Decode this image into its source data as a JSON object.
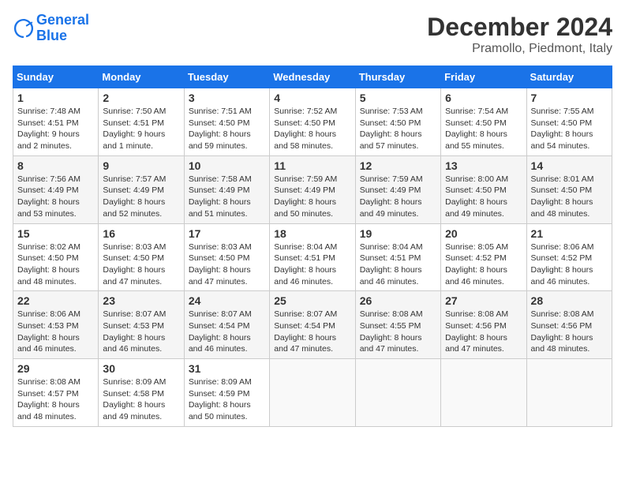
{
  "header": {
    "logo_line1": "General",
    "logo_line2": "Blue",
    "title": "December 2024",
    "subtitle": "Pramollo, Piedmont, Italy"
  },
  "calendar": {
    "days_of_week": [
      "Sunday",
      "Monday",
      "Tuesday",
      "Wednesday",
      "Thursday",
      "Friday",
      "Saturday"
    ],
    "weeks": [
      [
        {
          "day": "1",
          "sunrise": "Sunrise: 7:48 AM",
          "sunset": "Sunset: 4:51 PM",
          "daylight": "Daylight: 9 hours and 2 minutes."
        },
        {
          "day": "2",
          "sunrise": "Sunrise: 7:50 AM",
          "sunset": "Sunset: 4:51 PM",
          "daylight": "Daylight: 9 hours and 1 minute."
        },
        {
          "day": "3",
          "sunrise": "Sunrise: 7:51 AM",
          "sunset": "Sunset: 4:50 PM",
          "daylight": "Daylight: 8 hours and 59 minutes."
        },
        {
          "day": "4",
          "sunrise": "Sunrise: 7:52 AM",
          "sunset": "Sunset: 4:50 PM",
          "daylight": "Daylight: 8 hours and 58 minutes."
        },
        {
          "day": "5",
          "sunrise": "Sunrise: 7:53 AM",
          "sunset": "Sunset: 4:50 PM",
          "daylight": "Daylight: 8 hours and 57 minutes."
        },
        {
          "day": "6",
          "sunrise": "Sunrise: 7:54 AM",
          "sunset": "Sunset: 4:50 PM",
          "daylight": "Daylight: 8 hours and 55 minutes."
        },
        {
          "day": "7",
          "sunrise": "Sunrise: 7:55 AM",
          "sunset": "Sunset: 4:50 PM",
          "daylight": "Daylight: 8 hours and 54 minutes."
        }
      ],
      [
        {
          "day": "8",
          "sunrise": "Sunrise: 7:56 AM",
          "sunset": "Sunset: 4:49 PM",
          "daylight": "Daylight: 8 hours and 53 minutes."
        },
        {
          "day": "9",
          "sunrise": "Sunrise: 7:57 AM",
          "sunset": "Sunset: 4:49 PM",
          "daylight": "Daylight: 8 hours and 52 minutes."
        },
        {
          "day": "10",
          "sunrise": "Sunrise: 7:58 AM",
          "sunset": "Sunset: 4:49 PM",
          "daylight": "Daylight: 8 hours and 51 minutes."
        },
        {
          "day": "11",
          "sunrise": "Sunrise: 7:59 AM",
          "sunset": "Sunset: 4:49 PM",
          "daylight": "Daylight: 8 hours and 50 minutes."
        },
        {
          "day": "12",
          "sunrise": "Sunrise: 7:59 AM",
          "sunset": "Sunset: 4:49 PM",
          "daylight": "Daylight: 8 hours and 49 minutes."
        },
        {
          "day": "13",
          "sunrise": "Sunrise: 8:00 AM",
          "sunset": "Sunset: 4:50 PM",
          "daylight": "Daylight: 8 hours and 49 minutes."
        },
        {
          "day": "14",
          "sunrise": "Sunrise: 8:01 AM",
          "sunset": "Sunset: 4:50 PM",
          "daylight": "Daylight: 8 hours and 48 minutes."
        }
      ],
      [
        {
          "day": "15",
          "sunrise": "Sunrise: 8:02 AM",
          "sunset": "Sunset: 4:50 PM",
          "daylight": "Daylight: 8 hours and 48 minutes."
        },
        {
          "day": "16",
          "sunrise": "Sunrise: 8:03 AM",
          "sunset": "Sunset: 4:50 PM",
          "daylight": "Daylight: 8 hours and 47 minutes."
        },
        {
          "day": "17",
          "sunrise": "Sunrise: 8:03 AM",
          "sunset": "Sunset: 4:50 PM",
          "daylight": "Daylight: 8 hours and 47 minutes."
        },
        {
          "day": "18",
          "sunrise": "Sunrise: 8:04 AM",
          "sunset": "Sunset: 4:51 PM",
          "daylight": "Daylight: 8 hours and 46 minutes."
        },
        {
          "day": "19",
          "sunrise": "Sunrise: 8:04 AM",
          "sunset": "Sunset: 4:51 PM",
          "daylight": "Daylight: 8 hours and 46 minutes."
        },
        {
          "day": "20",
          "sunrise": "Sunrise: 8:05 AM",
          "sunset": "Sunset: 4:52 PM",
          "daylight": "Daylight: 8 hours and 46 minutes."
        },
        {
          "day": "21",
          "sunrise": "Sunrise: 8:06 AM",
          "sunset": "Sunset: 4:52 PM",
          "daylight": "Daylight: 8 hours and 46 minutes."
        }
      ],
      [
        {
          "day": "22",
          "sunrise": "Sunrise: 8:06 AM",
          "sunset": "Sunset: 4:53 PM",
          "daylight": "Daylight: 8 hours and 46 minutes."
        },
        {
          "day": "23",
          "sunrise": "Sunrise: 8:07 AM",
          "sunset": "Sunset: 4:53 PM",
          "daylight": "Daylight: 8 hours and 46 minutes."
        },
        {
          "day": "24",
          "sunrise": "Sunrise: 8:07 AM",
          "sunset": "Sunset: 4:54 PM",
          "daylight": "Daylight: 8 hours and 46 minutes."
        },
        {
          "day": "25",
          "sunrise": "Sunrise: 8:07 AM",
          "sunset": "Sunset: 4:54 PM",
          "daylight": "Daylight: 8 hours and 47 minutes."
        },
        {
          "day": "26",
          "sunrise": "Sunrise: 8:08 AM",
          "sunset": "Sunset: 4:55 PM",
          "daylight": "Daylight: 8 hours and 47 minutes."
        },
        {
          "day": "27",
          "sunrise": "Sunrise: 8:08 AM",
          "sunset": "Sunset: 4:56 PM",
          "daylight": "Daylight: 8 hours and 47 minutes."
        },
        {
          "day": "28",
          "sunrise": "Sunrise: 8:08 AM",
          "sunset": "Sunset: 4:56 PM",
          "daylight": "Daylight: 8 hours and 48 minutes."
        }
      ],
      [
        {
          "day": "29",
          "sunrise": "Sunrise: 8:08 AM",
          "sunset": "Sunset: 4:57 PM",
          "daylight": "Daylight: 8 hours and 48 minutes."
        },
        {
          "day": "30",
          "sunrise": "Sunrise: 8:09 AM",
          "sunset": "Sunset: 4:58 PM",
          "daylight": "Daylight: 8 hours and 49 minutes."
        },
        {
          "day": "31",
          "sunrise": "Sunrise: 8:09 AM",
          "sunset": "Sunset: 4:59 PM",
          "daylight": "Daylight: 8 hours and 50 minutes."
        },
        null,
        null,
        null,
        null
      ]
    ]
  }
}
